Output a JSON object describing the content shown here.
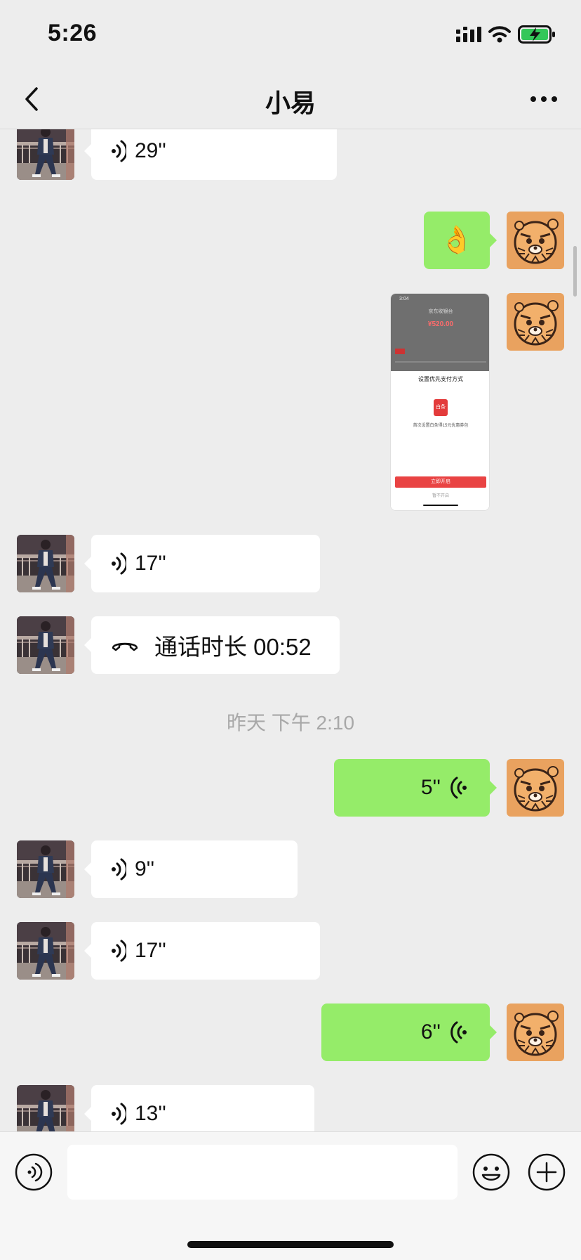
{
  "status_bar": {
    "time": "5:26"
  },
  "header": {
    "title": "小易",
    "back_icon": "chevron-left-icon",
    "more_icon": "ellipsis-icon"
  },
  "messages": {
    "m1": {
      "sender": "contact",
      "type": "voice",
      "duration": "29''"
    },
    "m2": {
      "sender": "me",
      "type": "emoji",
      "text": "👌"
    },
    "m3": {
      "sender": "me",
      "type": "image",
      "screenshot": {
        "time": "3:04",
        "title": "京东收银台",
        "amount": "¥520.00",
        "sheet_title": "设置优先支付方式",
        "brand": "白条",
        "promo": "首次设置白条得15元优惠券包",
        "primary_button": "立即开启",
        "secondary_button": "暂不开启"
      }
    },
    "m4": {
      "sender": "contact",
      "type": "voice",
      "duration": "17''"
    },
    "m5": {
      "sender": "contact",
      "type": "call",
      "text": "通话时长 00:52"
    },
    "ts1": "昨天 下午 2:10",
    "m6": {
      "sender": "me",
      "type": "voice",
      "duration": "5''"
    },
    "m7": {
      "sender": "contact",
      "type": "voice",
      "duration": "9''"
    },
    "m8": {
      "sender": "contact",
      "type": "voice",
      "duration": "17''"
    },
    "m9": {
      "sender": "me",
      "type": "voice",
      "duration": "6''"
    },
    "m10": {
      "sender": "contact",
      "type": "voice",
      "duration": "13''"
    }
  },
  "input_bar": {
    "input_value": "",
    "voice_icon": "voice-mode-icon",
    "emoji_icon": "emoji-icon",
    "plus_icon": "plus-icon"
  },
  "colors": {
    "background": "#ededed",
    "outgoing_bubble": "#95ec69",
    "incoming_bubble": "#ffffff",
    "my_avatar": "#e9a25f",
    "timestamp_text": "#a8a8a8"
  }
}
